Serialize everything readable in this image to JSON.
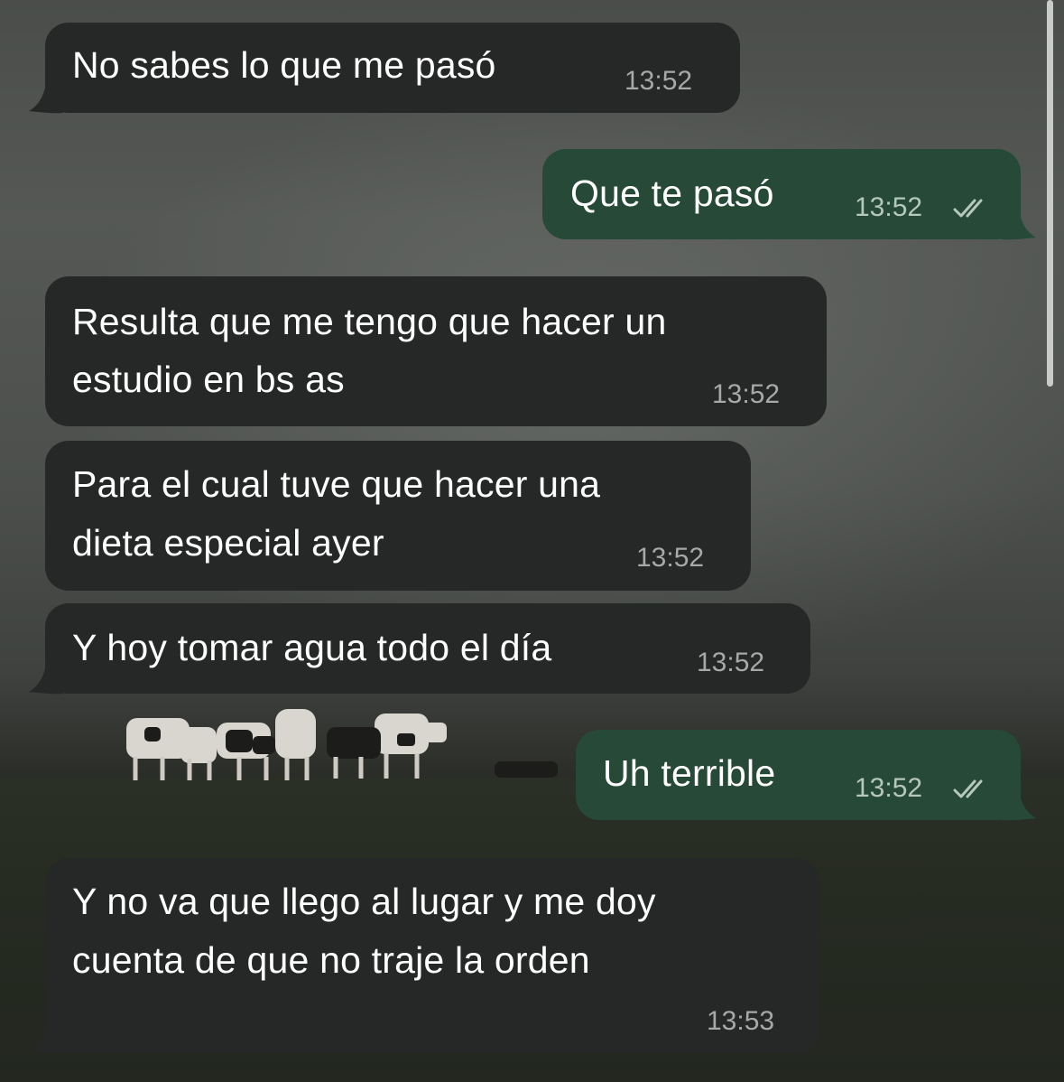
{
  "colors": {
    "incoming_bubble": "#262827",
    "outgoing_bubble": "#264a37",
    "text": "#ffffff",
    "timestamp": "#a7a9a7"
  },
  "icons": {
    "read_receipt": "double-check-icon"
  },
  "messages": [
    {
      "direction": "incoming",
      "lines": [
        "No sabes lo que me pasó"
      ],
      "time": "13:52"
    },
    {
      "direction": "outgoing",
      "lines": [
        "Que te pasó"
      ],
      "time": "13:52",
      "status": "read"
    },
    {
      "direction": "incoming",
      "lines": [
        "Resulta que me tengo que hacer un",
        "estudio en bs as"
      ],
      "time": "13:52"
    },
    {
      "direction": "incoming",
      "lines": [
        "Para el cual tuve que hacer una",
        "dieta especial ayer"
      ],
      "time": "13:52"
    },
    {
      "direction": "incoming",
      "lines": [
        "Y hoy tomar agua todo el día"
      ],
      "time": "13:52"
    },
    {
      "direction": "outgoing",
      "lines": [
        "Uh terrible"
      ],
      "time": "13:52",
      "status": "read"
    },
    {
      "direction": "incoming",
      "lines": [
        "Y no va que llego al lugar y me doy",
        "cuenta de que no traje la orden"
      ],
      "time": "13:53"
    }
  ]
}
